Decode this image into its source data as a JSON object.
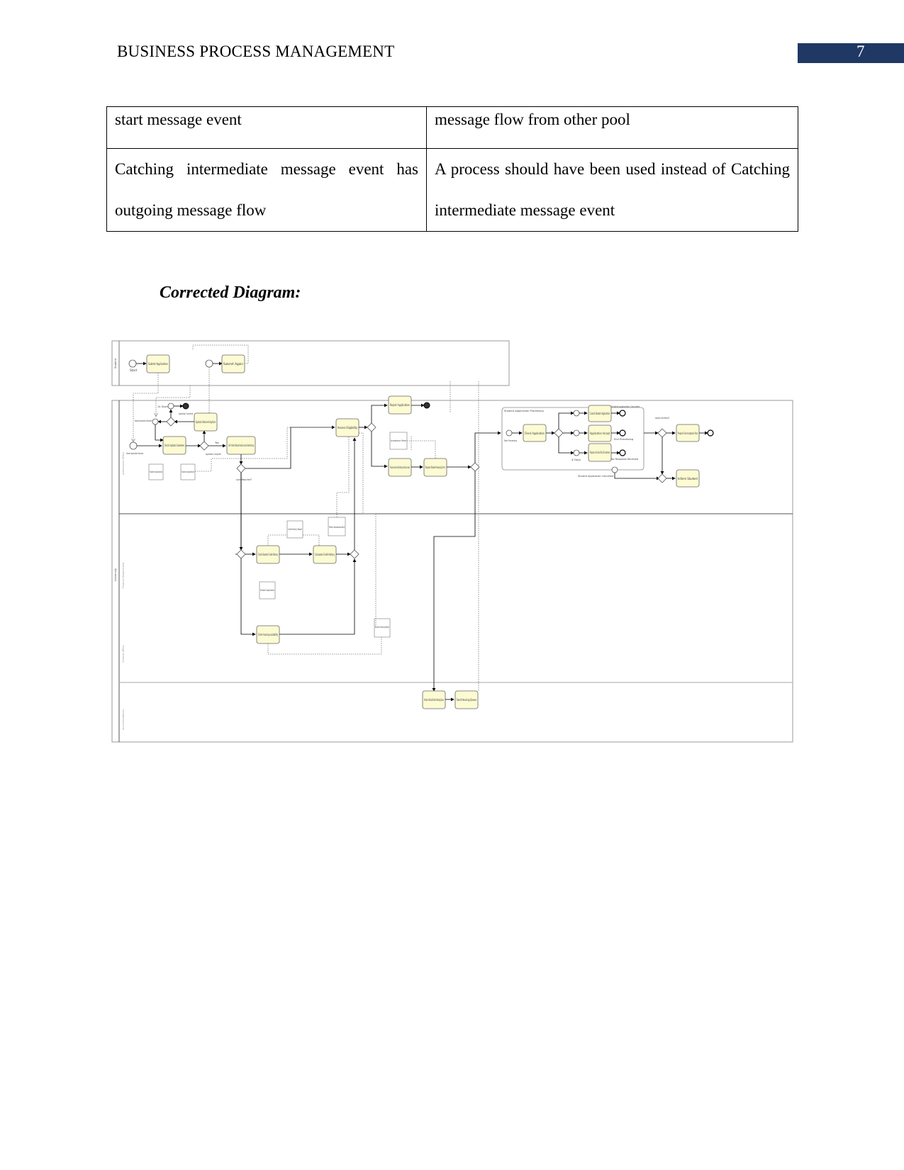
{
  "header": {
    "running_title": "BUSINESS PROCESS MANAGEMENT",
    "page_number": "7",
    "accent_color": "#1f3864"
  },
  "error_table": {
    "rows": [
      {
        "error": "start message event",
        "correction": "message flow from other pool"
      },
      {
        "error": "Catching intermediate message event has outgoing message flow",
        "correction": "A process should have been used instead of Catching intermediate message event"
      }
    ]
  },
  "section_title": "Corrected Diagram:",
  "diagram": {
    "task_fill": "#fdfbd3",
    "pools": [
      {
        "label": "Student",
        "top_label": "Student"
      },
      {
        "label": "University",
        "lanes": [
          "Admissions Office",
          "Finance Department",
          "Central Office",
          "Accommodation"
        ]
      }
    ],
    "tasks": {
      "submit_application": "Submit Application",
      "submit_again": "Submit Again",
      "check_completeness": "Check for Application Completeness",
      "application_returned": "Application Returned to Applicant",
      "check_loan_housing": "Check if Student Requires Student Loan and Student Housing",
      "assess_eligibility": "Assess Eligibility",
      "reject_application": "Reject Application",
      "prepare_admission_pack": "Prepare and send preliminary admission pack",
      "request_housing": "Request Student Housing Form",
      "check_student_credit": "Check Student Credit History",
      "calculate_credit": "Calculate Credit History",
      "check_housing": "Check housing availability",
      "check_application": "Check Application",
      "cancel_student_application": "Cancel Student Application",
      "application_accept": "Application Accept",
      "prepare_send_enrollment": "Prepare and Send Final Enrollment",
      "prepare_final_pack": "Prepare Final Acceptance Pack",
      "inform_student": "Inform Student",
      "prepare_housing_queue": "Prepare Individual Student Housing Queue",
      "send_housing_queue": "Send Housing Queue"
    },
    "data_objects": {
      "student_application_1": "Student Application",
      "student_application_2": "Student Application",
      "student_application_3": "Student Application",
      "acceptance_sheet": "Acceptance Sheet",
      "credit_history_report": "Credit History Report",
      "risk_assessment": "Risk Assessment",
      "student_housing_report": "Student Housing Report"
    },
    "events": {
      "start": "Start",
      "student_application_received": "Student Application Received",
      "updated_application_received": "Updated Application Received",
      "timer_14days": "14 Days",
      "application_cancelled": "Application Cancelled",
      "start_processing": "Start Processing",
      "end_processing": "End Processing",
      "student_application_cancelled": "Student Application Cancelled",
      "no_response_received": "No Response Received",
      "timer_days": "# Days",
      "cancellation": "Student Application Cancelled"
    },
    "gateways": {
      "application_complete": "Application Complete?",
      "loan_required": "Loan Required?",
      "application_letter_received": "Application Letter Received?",
      "yes": "Yes",
      "no": "No"
    },
    "subprocess_label": "Student Application Processing"
  }
}
